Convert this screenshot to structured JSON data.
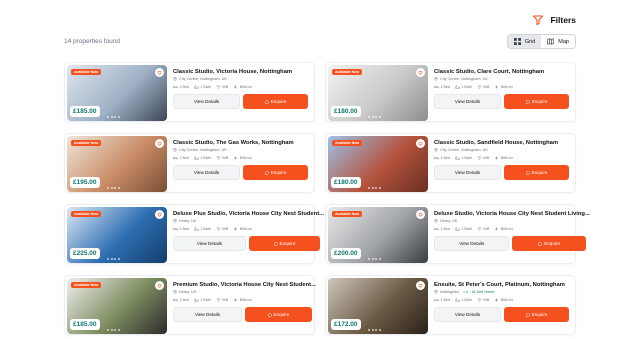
{
  "header": {
    "filters_label": "Filters",
    "count_text": "14 properties found",
    "views": [
      {
        "label": "Grid",
        "icon": "grid-icon",
        "active": true
      },
      {
        "label": "Map",
        "icon": "map-icon",
        "active": false
      }
    ]
  },
  "colors": {
    "accent": "#f4511e",
    "price": "#0f766e"
  },
  "card_labels": {
    "badge": "Available Now",
    "details": "View Details",
    "enquire": "Enquire"
  },
  "properties": [
    {
      "title": "Classic Studio, Victoria House, Nottingham",
      "location": "City Centre, Nottingham, UK",
      "tag": "",
      "price": "£185.00",
      "bed": "1 Bed",
      "bath": "1 Bath",
      "wifi": "Wifi",
      "bills": "Bills Inc",
      "badge": true,
      "photo": [
        "#dfe6ee",
        "#9fb1c6",
        "#3b4656"
      ]
    },
    {
      "title": "Classic Studio, Clare Court, Nottingham",
      "location": "City Centre, Nottingham, UK",
      "tag": "",
      "price": "£180.00",
      "bed": "1 Bed",
      "bath": "1 Bath",
      "wifi": "Wifi",
      "bills": "Bills Inc",
      "badge": true,
      "photo": [
        "#f2f2f2",
        "#c9c9c9",
        "#8d8d8d"
      ]
    },
    {
      "title": "Classic Studio, The Gas Works, Nottingham",
      "location": "City Centre, Nottingham, UK",
      "tag": "",
      "price": "£195.00",
      "bed": "1 Bed",
      "bath": "1 Bath",
      "wifi": "Wifi",
      "bills": "Bills Inc",
      "badge": true,
      "photo": [
        "#eee5da",
        "#c98c66",
        "#7a4f36"
      ]
    },
    {
      "title": "Classic Studio, Sandfield House, Nottingham",
      "location": "City Centre, Nottingham, UK",
      "tag": "",
      "price": "£180.00",
      "bed": "1 Bed",
      "bath": "1 Bath",
      "wifi": "Wifi",
      "bills": "Bills Inc",
      "badge": true,
      "photo": [
        "#9cc2ea",
        "#b4533d",
        "#6a2f24"
      ]
    },
    {
      "title": "Deluxe Plus Studio, Victoria House City Nest Student...",
      "location": "Derby, UK",
      "tag": "",
      "price": "£225.00",
      "bed": "1 Bed",
      "bath": "1 Bath",
      "wifi": "Wifi",
      "bills": "Bills Inc",
      "badge": true,
      "photo": [
        "#dde9f5",
        "#2f6fb3",
        "#123e6c"
      ]
    },
    {
      "title": "Deluxe Studio, Victoria House City Nest Student Living...",
      "location": "Derby, UK",
      "tag": "",
      "price": "£200.00",
      "bed": "1 Bed",
      "bath": "1 Bath",
      "wifi": "Wifi",
      "bills": "Bills Inc",
      "badge": true,
      "photo": [
        "#e8e8e8",
        "#a0a4a8",
        "#3a3d40"
      ]
    },
    {
      "title": "Premium Studio, Victoria House City Nest Student...",
      "location": "Derby, UK",
      "tag": "",
      "price": "£185.00",
      "bed": "1 Bed",
      "bath": "1 Bath",
      "wifi": "Wifi",
      "bills": "Bills Inc",
      "badge": true,
      "photo": [
        "#f0f0f0",
        "#7d8d5f",
        "#2c2c2c"
      ]
    },
    {
      "title": "Ensuite, St Peter's Court, Platinum, Nottingham",
      "location": "Nottingham",
      "tag": "• 4 - 18 Unit Home",
      "price": "£172.00",
      "bed": "1 Bed",
      "bath": "1 Bath",
      "wifi": "Wifi",
      "bills": "Bills Inc",
      "badge": false,
      "photo": [
        "#cfc7bb",
        "#6b5b45",
        "#2a2119"
      ]
    }
  ]
}
